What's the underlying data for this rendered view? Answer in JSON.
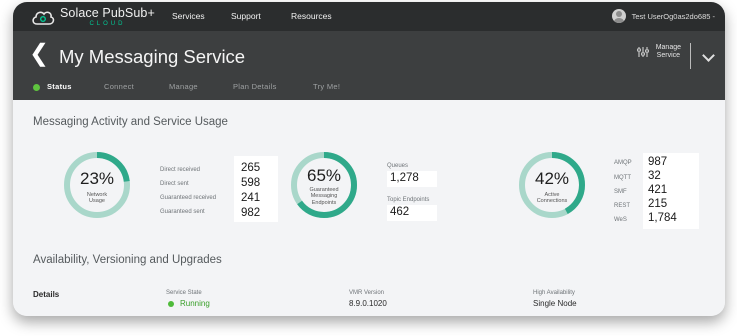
{
  "brand": {
    "name": "Solace PubSub+",
    "sub": "CLOUD"
  },
  "topnav": [
    "Services",
    "Support",
    "Resources"
  ],
  "user": {
    "name": "Test UserOg0as2do685 -"
  },
  "header": {
    "back_icon": "chevron-left-icon",
    "title": "My Messaging Service",
    "manage_label_1": "Manage",
    "manage_label_2": "Service"
  },
  "tabs": [
    "Status",
    "Connect",
    "Manage",
    "Plan Details",
    "Try Me!"
  ],
  "sections": {
    "activity_title": "Messaging Activity and Service Usage",
    "availability_title": "Availability, Versioning and Upgrades"
  },
  "network": {
    "percent_text": "23%",
    "percent": 23,
    "label_1": "Network",
    "label_2": "Usage",
    "stats": [
      {
        "label": "Direct received",
        "value": "265"
      },
      {
        "label": "Direct sent",
        "value": "598"
      },
      {
        "label": "Guaranteed received",
        "value": "241"
      },
      {
        "label": "Guaranteed sent",
        "value": "982"
      }
    ]
  },
  "endpoints": {
    "percent_text": "65%",
    "percent": 65,
    "label_1": "Guaranteed",
    "label_2": "Messaging",
    "label_3": "Endpoints",
    "queues_label": "Queues",
    "queues_value": "1,278",
    "topic_label": "Topic Endpoints",
    "topic_value": "462"
  },
  "connections": {
    "percent_text": "42%",
    "percent": 42,
    "label_1": "Active",
    "label_2": "Connections",
    "stats": [
      {
        "label": "AMQP",
        "value": "987"
      },
      {
        "label": "MQTT",
        "value": "32"
      },
      {
        "label": "SMF",
        "value": "421"
      },
      {
        "label": "REST",
        "value": "215"
      },
      {
        "label": "WeS",
        "value": "1,784"
      }
    ]
  },
  "details": {
    "title": "Details",
    "service_state_label": "Service State",
    "service_state": "Running",
    "vmr_label": "VMR Version",
    "vmr_value": "8.9.0.1020",
    "ha_label": "High Availability",
    "ha_value": "Single Node"
  },
  "colors": {
    "accent": "#2fa98a",
    "track": "#a9d7ca",
    "running": "#4fbb3a"
  }
}
